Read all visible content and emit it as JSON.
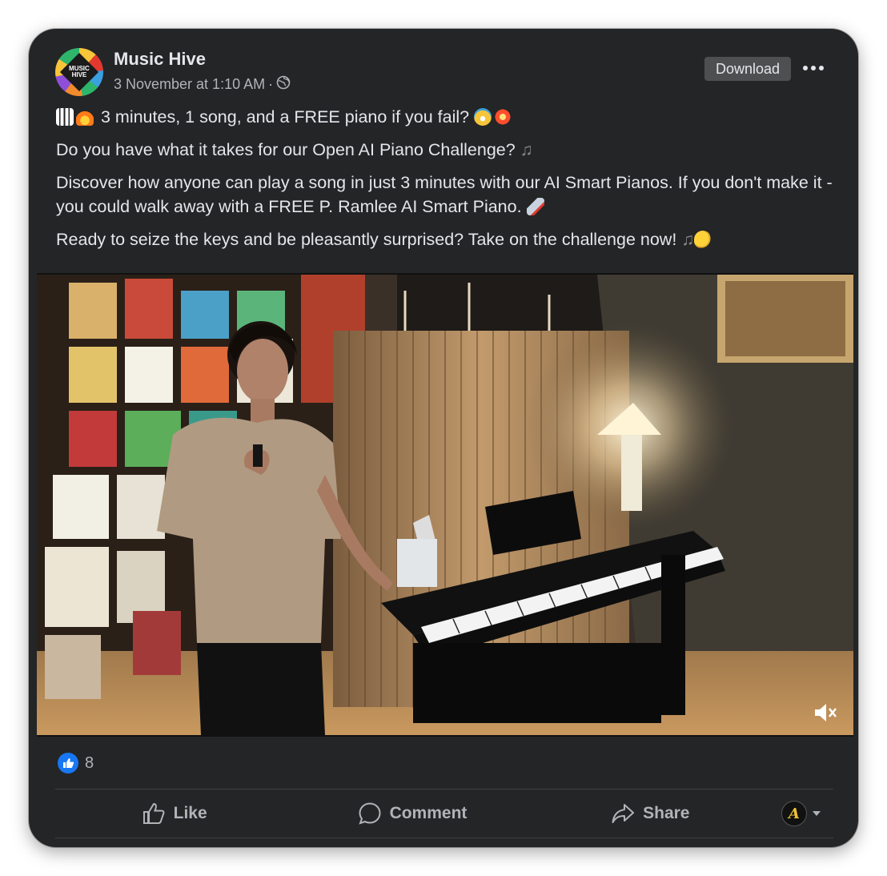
{
  "post": {
    "page_name": "Music Hive",
    "logo_text": "MUSIC\nHIVE",
    "timestamp": "3 November at 1:10 AM",
    "meta_separator": "·",
    "privacy_icon": "globe-icon",
    "download_label": "Download",
    "more_icon": "more-horizontal-icon",
    "paragraphs": [
      {
        "emojis": [
          "piano-emoji",
          "fire-emoji"
        ],
        "text": "3 minutes, 1 song, and a FREE piano if you fail?",
        "trailing_emojis": [
          "scream-emoji",
          "collision-emoji"
        ]
      },
      {
        "emojis": [],
        "text": "Do you have what it takes for our Open AI Piano Challenge?",
        "trailing_emojis": [
          "musical-note-emoji"
        ]
      },
      {
        "emojis": [],
        "text": "Discover how anyone can play a song in just 3 minutes with our AI Smart Pianos. If you don't make it - you could walk away with a FREE P. Ramlee AI Smart Piano.",
        "trailing_emojis": [
          "rocket-emoji"
        ]
      },
      {
        "emojis": [],
        "text": "Ready to seize the keys and be pleasantly surprised? Take on the challenge now!",
        "trailing_emojis": [
          "musical-notes-emoji",
          "flexed-biceps-emoji"
        ]
      }
    ]
  },
  "video": {
    "mute_icon": "muted-speaker-icon",
    "scene": "woman standing beside a black digital piano in a music shop with sheet-music racks and a lamp"
  },
  "reactions": {
    "icon": "like-reaction-icon",
    "count": "8"
  },
  "actions": {
    "like": {
      "label": "Like",
      "icon": "thumbs-up-icon"
    },
    "comment": {
      "label": "Comment",
      "icon": "comment-icon"
    },
    "share": {
      "label": "Share",
      "icon": "share-icon"
    },
    "audience_initial": "A",
    "audience_icon": "caret-down-icon"
  },
  "colors": {
    "card_bg": "#242526",
    "text_primary": "#e4e6eb",
    "text_secondary": "#b0b3b8",
    "like_blue": "#1877f2",
    "button_bg": "#4e4f50"
  }
}
